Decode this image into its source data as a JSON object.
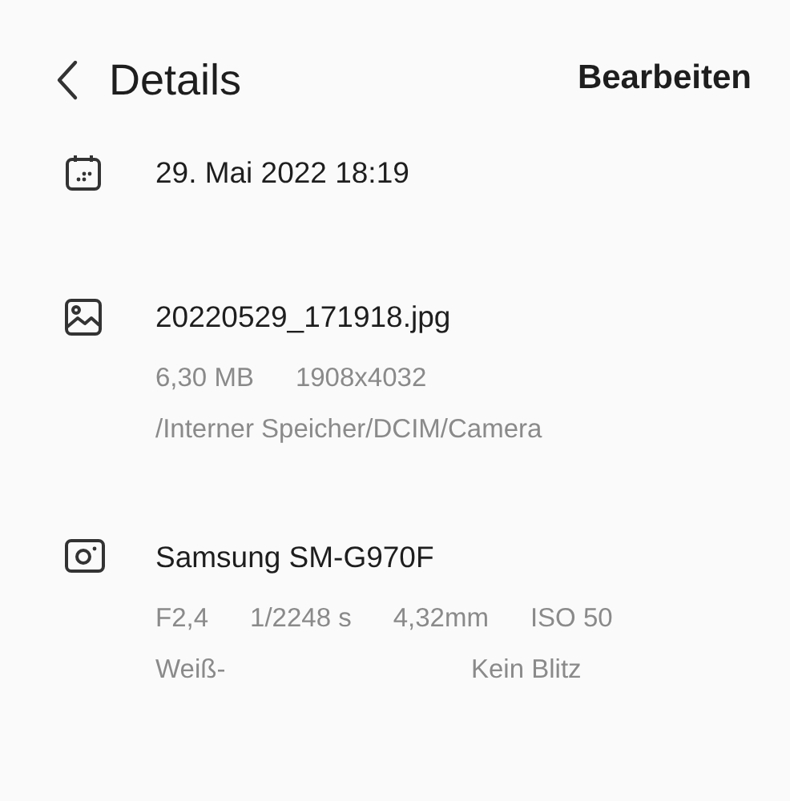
{
  "header": {
    "title": "Details",
    "action": "Bearbeiten"
  },
  "sections": [
    {
      "kind": "date",
      "title": "29. Mai 2022 18:19"
    },
    {
      "kind": "file",
      "title": "20220529_171918.jpg",
      "rows": [
        {
          "kind": "inline",
          "items": [
            "6,30 MB",
            "1908x4032"
          ]
        },
        {
          "kind": "inline",
          "items": [
            "/Interner Speicher/DCIM/Camera"
          ]
        }
      ]
    },
    {
      "kind": "camera",
      "title": "Samsung SM-G970F",
      "rows": [
        {
          "kind": "inline",
          "items": [
            "F2,4",
            "1/2248 s",
            "4,32mm",
            "ISO 50"
          ]
        },
        {
          "kind": "split",
          "items": [
            "Weiß-",
            "Kein Blitz"
          ]
        }
      ]
    }
  ]
}
